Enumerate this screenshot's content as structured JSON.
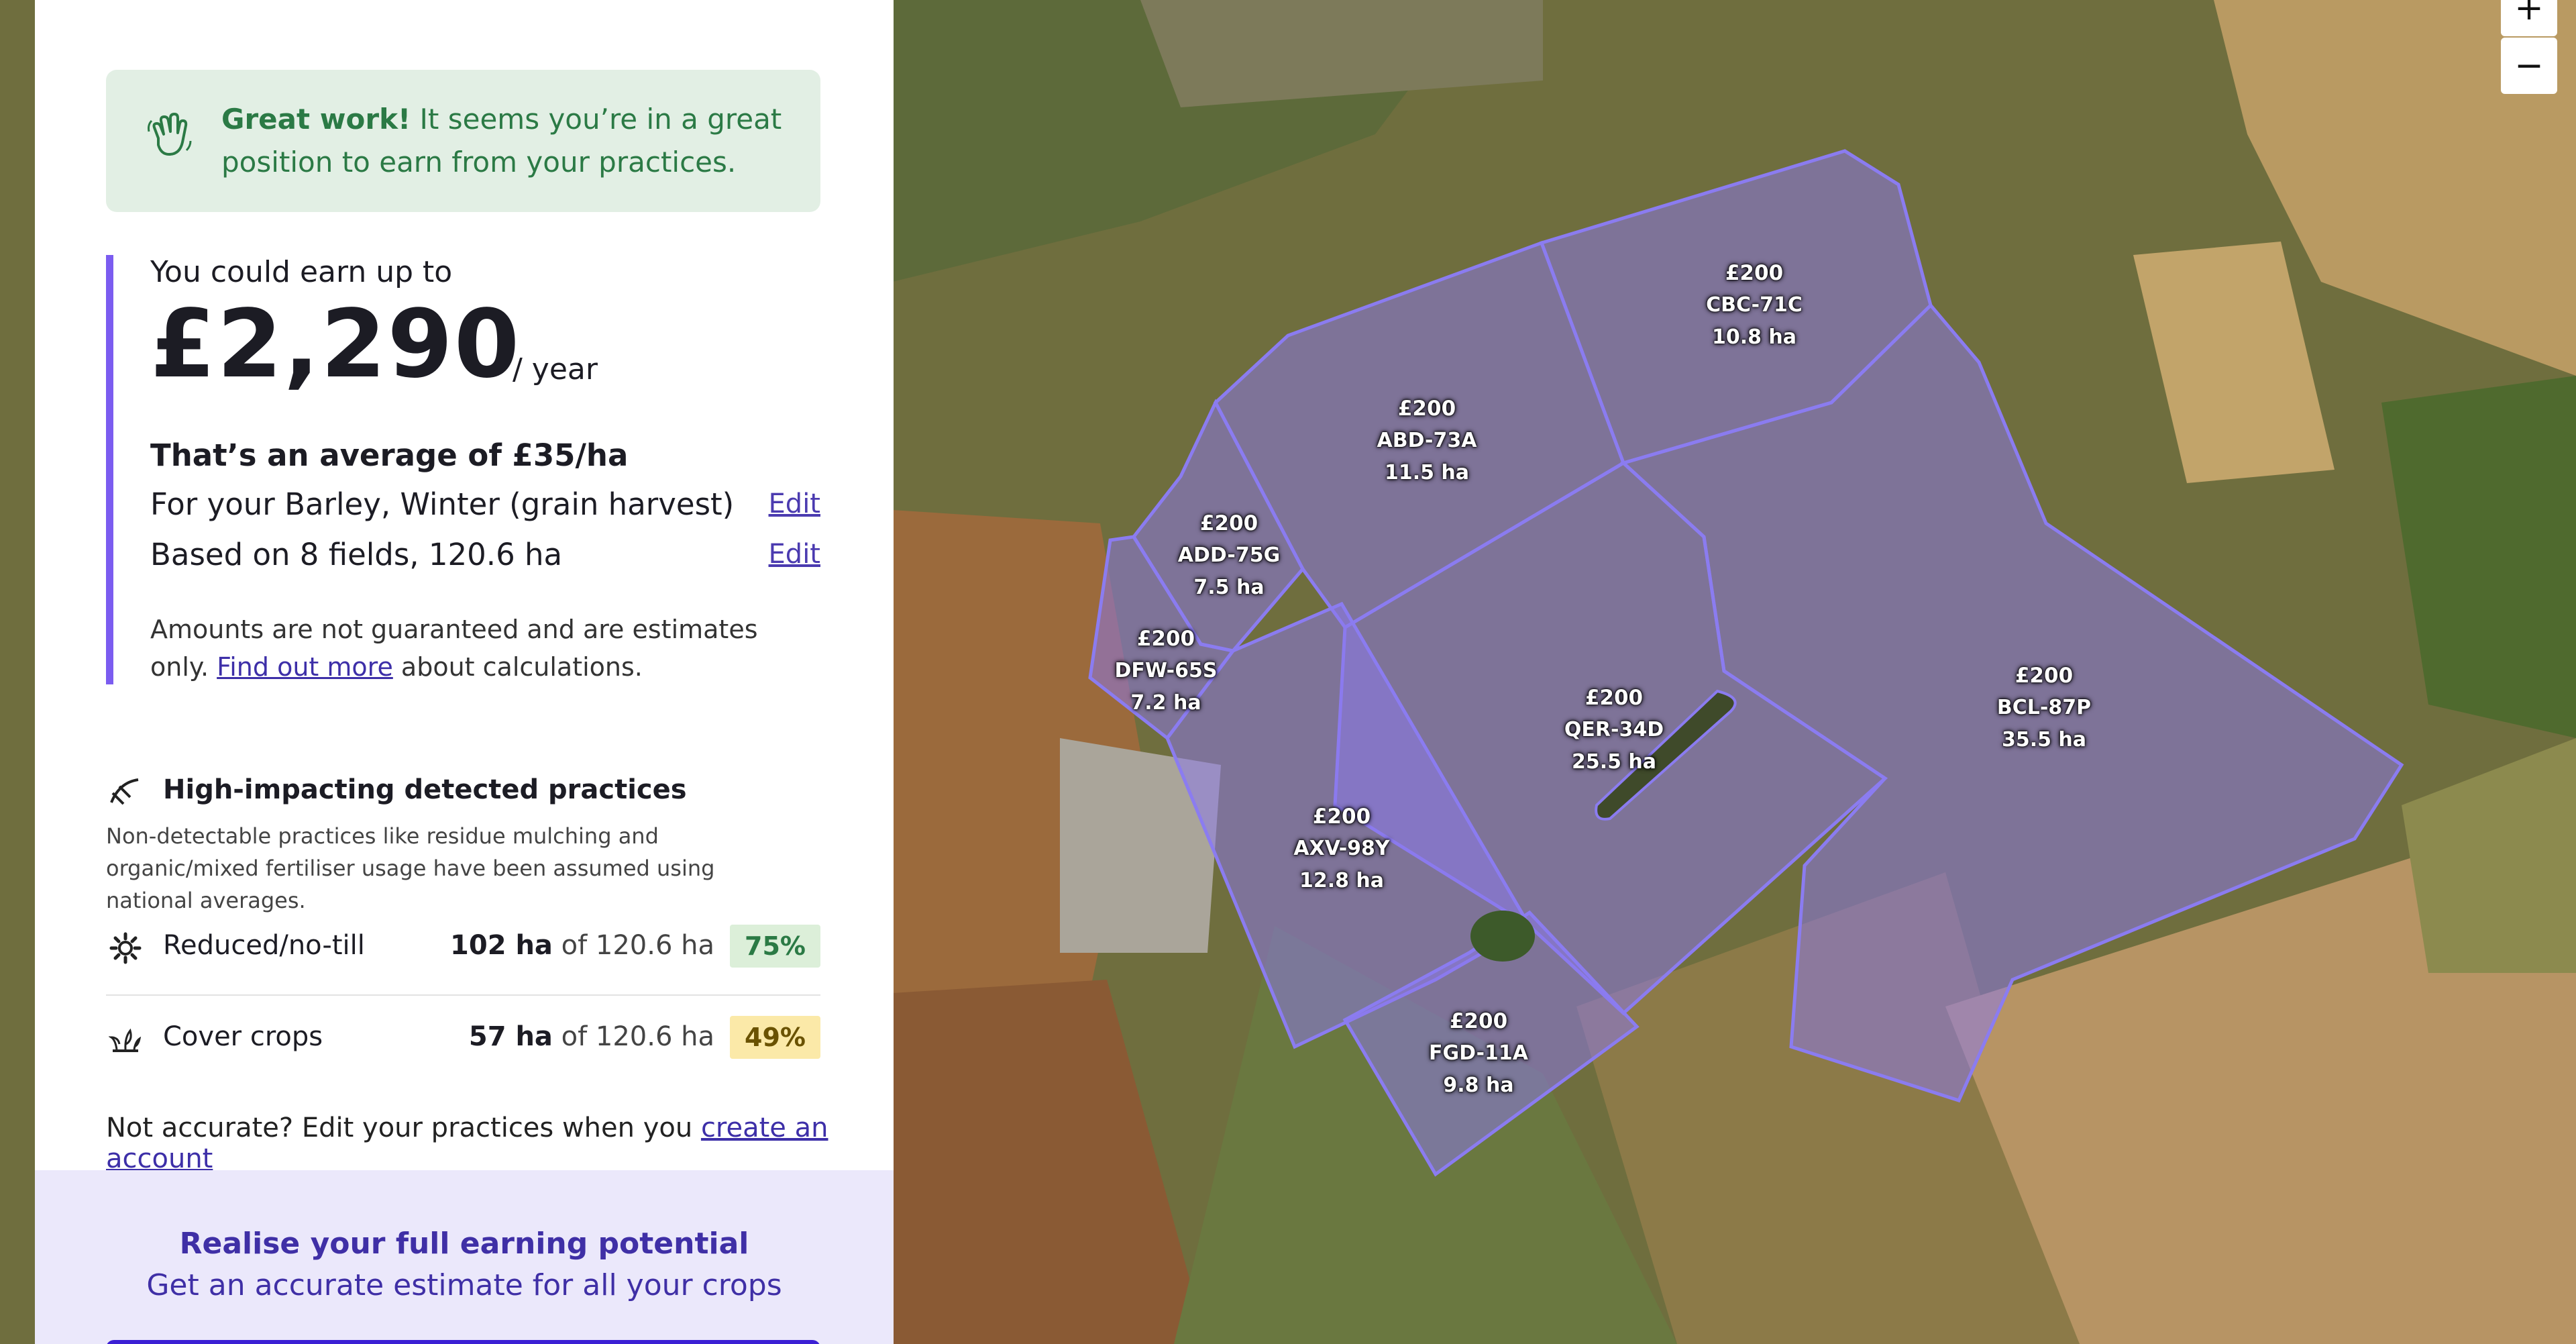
{
  "banner": {
    "title": "Great work!",
    "text": "It seems you’re in a great position to earn from your practices."
  },
  "earnings": {
    "lead": "You could earn up to",
    "amount": "£2,290",
    "period": "/ year",
    "average": "That’s an average of £35/ha",
    "crop_text": "For your Barley, Winter (grain harvest)",
    "fields_text": "Based on 8 fields, 120.6 ha",
    "edit_label": "Edit",
    "disclaimer": "Amounts are not guaranteed and are estimates only.",
    "find_out_more": "Find out more",
    "about_calc": "about calculations."
  },
  "practices": {
    "heading": "High-impacting detected practices",
    "description": "Non-detectable practices like residue mulching and organic/mixed fertiliser usage have been assumed using national averages.",
    "items": [
      {
        "name": "Reduced/no-till",
        "value": "102 ha",
        "of": "of 120.6 ha",
        "percent": "75%",
        "percent_bg": "#dcefd9",
        "percent_color": "#2b7a45",
        "icon": "gear-icon"
      },
      {
        "name": "Cover crops",
        "value": "57 ha",
        "of": "of 120.6 ha",
        "percent": "49%",
        "percent_bg": "#fbe9a8",
        "percent_color": "#6a5200",
        "icon": "seedling-icon"
      }
    ]
  },
  "accuracy": {
    "prefix": "Not accurate?",
    "text": "Edit your practices when you",
    "link": "create an account"
  },
  "cta": {
    "title": "Realise your full earning potential",
    "subtitle": "Get an accurate estimate for all your crops"
  },
  "map": {
    "zoom_in": "+",
    "zoom_out": "−",
    "fields": [
      {
        "price": "£200",
        "code": "CBC-71C",
        "area": "10.8 ha"
      },
      {
        "price": "£200",
        "code": "ABD-73A",
        "area": "11.5 ha"
      },
      {
        "price": "£200",
        "code": "ADD-75G",
        "area": "7.5 ha"
      },
      {
        "price": "£200",
        "code": "DFW-65S",
        "area": "7.2 ha"
      },
      {
        "price": "£200",
        "code": "QER-34D",
        "area": "25.5 ha"
      },
      {
        "price": "£200",
        "code": "BCL-87P",
        "area": "35.5 ha"
      },
      {
        "price": "£200",
        "code": "AXV-98Y",
        "area": "12.8 ha"
      },
      {
        "price": "£200",
        "code": "FGD-11A",
        "area": "9.8 ha"
      }
    ]
  },
  "colors": {
    "accent": "#7b5cf0",
    "field_fill": "#8c78eb",
    "banner_bg": "#e2efe4",
    "link": "#3d2fa8"
  }
}
